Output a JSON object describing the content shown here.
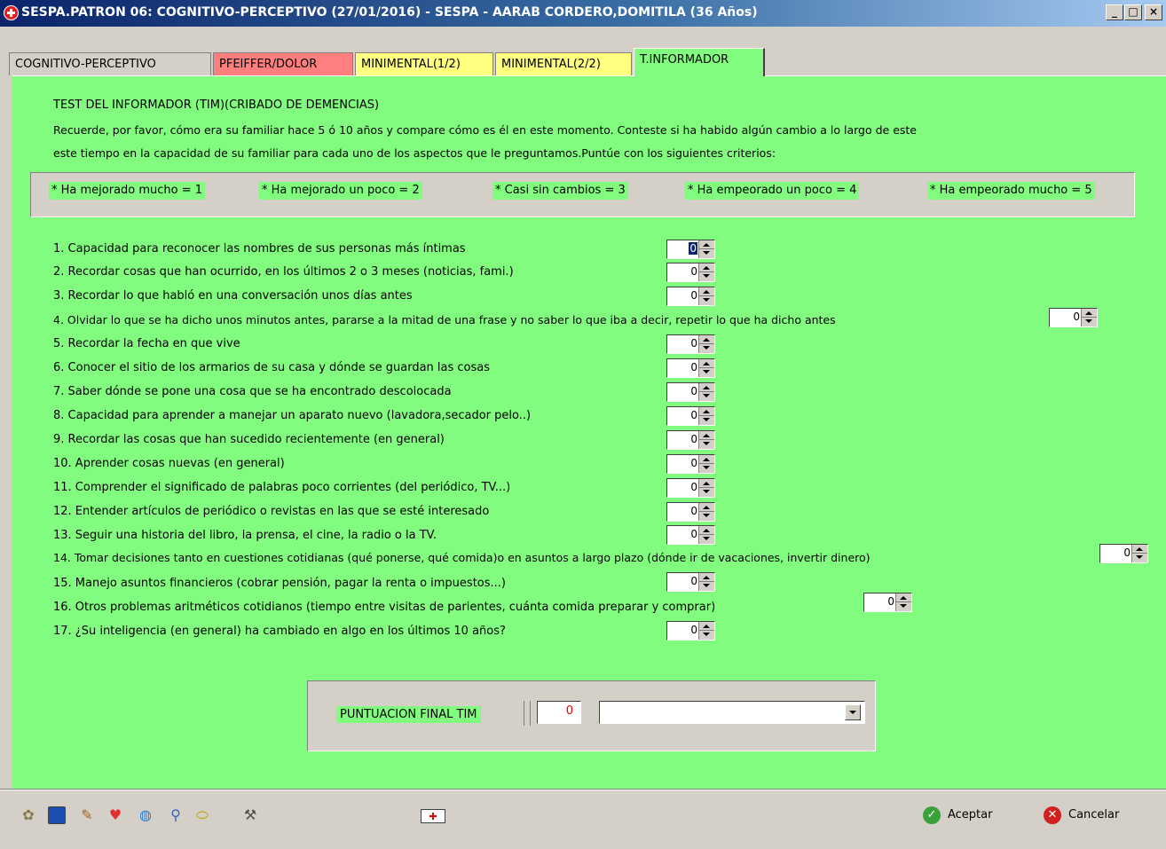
{
  "window": {
    "title": "SESPA.PATRON 06: COGNITIVO-PERCEPTIVO (27/01/2016) - SESPA - AARAB CORDERO,DOMITILA (36 Años)",
    "min_label": "_",
    "max_label": "□",
    "close_label": "×"
  },
  "tabs": [
    {
      "label": "COGNITIVO-PERCEPTIVO",
      "color": "#d4d0c8"
    },
    {
      "label": "PFEIFFER/DOLOR",
      "color": "#ff7f7f"
    },
    {
      "label": "MINIMENTAL(1/2)",
      "color": "#ffff80"
    },
    {
      "label": "MINIMENTAL(2/2)",
      "color": "#ffff80"
    },
    {
      "label": "T.INFORMADOR",
      "color": "#82fc7e"
    }
  ],
  "test": {
    "heading": "TEST DEL INFORMADOR (TIM)(CRIBADO DE DEMENCIAS)",
    "instructions_1": "Recuerde, por favor, cómo era su familiar hace 5 ó 10 años y compare cómo es él  en este momento. Conteste si ha habido algún cambio a lo largo de este",
    "instructions_2": "este tiempo en la capacidad de su familiar para cada uno de los aspectos que le preguntamos.Puntúe con los siguientes criterios:"
  },
  "criteria": [
    "* Ha mejorado mucho = 1",
    "* Ha mejorado un poco = 2",
    "* Casi sin cambios = 3",
    "* Ha empeorado un poco = 4",
    "* Ha empeorado mucho = 5"
  ],
  "questions": [
    {
      "text": "1. Capacidad para reconocer las nombres de sus personas más íntimas",
      "value": "0"
    },
    {
      "text": "2. Recordar cosas que han ocurrido, en los últimos 2 o 3 meses (noticias, fami.)",
      "value": "0"
    },
    {
      "text": "3. Recordar lo que habló en una conversación unos días antes",
      "value": "0"
    },
    {
      "text": "4. Olvidar lo que se ha dicho unos minutos antes, pararse a la mitad de una  frase y no saber lo que iba a decir, repetir lo que ha dicho antes",
      "value": "0"
    },
    {
      "text": "5.  Recordar la fecha en que vive",
      "value": "0"
    },
    {
      "text": "6. Conocer el sitio de los armarios de su casa y dónde se guardan las cosas",
      "value": "0"
    },
    {
      "text": "7. Saber dónde se pone una cosa que se ha encontrado descolocada",
      "value": "0"
    },
    {
      "text": "8. Capacidad para aprender a manejar un aparato nuevo (lavadora,secador pelo..)",
      "value": "0"
    },
    {
      "text": "9.  Recordar las cosas que han sucedido recientemente (en general)",
      "value": "0"
    },
    {
      "text": "10. Aprender cosas nuevas (en general)",
      "value": "0"
    },
    {
      "text": "11. Comprender el significado de palabras poco corrientes (del periódico, TV...)",
      "value": "0"
    },
    {
      "text": "12. Entender artículos de periódico o revistas en las que se esté interesado",
      "value": "0"
    },
    {
      "text": "13. Seguir una historia del libro, la prensa, el cine, la radio o la TV.",
      "value": "0"
    },
    {
      "text": "14. Tomar decisiones tanto en cuestiones cotidianas (qué  ponerse, qué comida)o en asuntos a largo plazo (dónde ir de vacaciones, invertir dinero)",
      "value": "0"
    },
    {
      "text": "15. Manejo asuntos financieros (cobrar pensión, pagar la renta o impuestos...)",
      "value": "0"
    },
    {
      "text": "16. Otros problemas aritméticos cotidianos (tiempo entre visitas de parientes, cuánta comida preparar y comprar)",
      "value": "0"
    },
    {
      "text": "17. ¿Su inteligencia (en general) ha cambiado en algo en los últimos 10 años?",
      "value": "0"
    }
  ],
  "final": {
    "label": "PUNTUACION FINAL TIM",
    "score": "0",
    "selected": ""
  },
  "toolbar": {
    "icons": [
      "puzzle-icon",
      "monitor-icon",
      "pencil-icon",
      "heart-icon",
      "globe-icon",
      "magnifier-icon",
      "pill-icon",
      "tools-icon",
      "medical-card-icon"
    ]
  },
  "actions": {
    "accept": "Aceptar",
    "cancel": "Cancelar"
  },
  "colors": {
    "panel_green": "#82fc7e",
    "accept_green": "#3aa23a",
    "cancel_red": "#d02020"
  }
}
